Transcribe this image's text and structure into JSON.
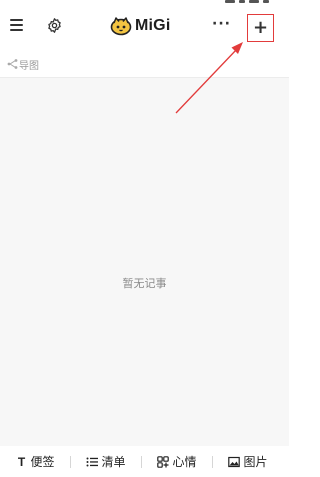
{
  "header": {
    "logo_text": "MiGi",
    "more_label": "···",
    "add_label": "+"
  },
  "subbar": {
    "label": "导图"
  },
  "main": {
    "empty_message": "暂无记事"
  },
  "bottom_bar": {
    "items": [
      {
        "label": "便签",
        "icon": "text-icon"
      },
      {
        "label": "清单",
        "icon": "list-icon"
      },
      {
        "label": "心情",
        "icon": "mood-icon"
      },
      {
        "label": "图片",
        "icon": "image-icon"
      }
    ]
  },
  "colors": {
    "annotation": "#e23b3b",
    "content_background": "#f7f7f7"
  }
}
